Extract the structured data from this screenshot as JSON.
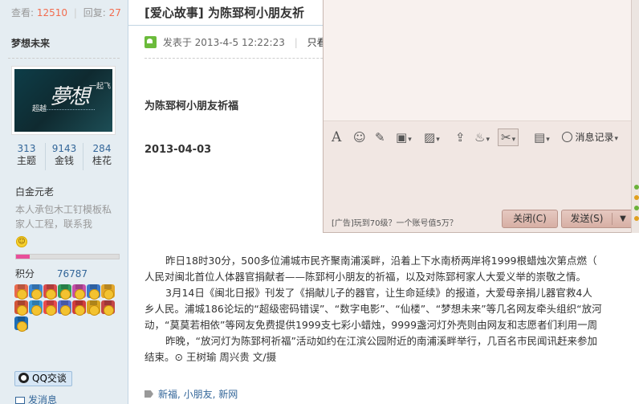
{
  "header": {
    "views_label": "查看:",
    "views_count": "12510",
    "replies_label": "回复:",
    "replies_count": "27",
    "thread_category": "[爱心故事]",
    "thread_title": "为陈郅柯小朋友祈"
  },
  "author": {
    "name": "梦想未来",
    "avatar_text_main": "夢想",
    "avatar_text_left": "超越",
    "avatar_text_right": "一起飞",
    "stats": [
      {
        "value": "313",
        "label": "主题"
      },
      {
        "value": "9143",
        "label": "金钱"
      },
      {
        "value": "284",
        "label": "桂花"
      }
    ],
    "group": "白金元老",
    "intro": "本人承包木工钉模板私家人工程，联系我",
    "level_progress": 0.13,
    "points_label": "积分",
    "points_value": "76787",
    "qq_label": "QQ交谈",
    "pm_label": "发消息"
  },
  "post": {
    "posted_prefix": "发表于",
    "posted_time": "2013-4-5 12:22:23",
    "only_author": "只看该",
    "heading": "为陈郅柯小朋友祈福",
    "date": "2013-04-03",
    "paragraphs": [
      "昨日18时30分，500多位浦城市民齐聚南浦溪畔，沿着上下水南桥两岸将1999根蜡烛次第点燃（",
      "人民对闽北首位人体器官捐献者——陈郅柯小朋友的祈福，以及对陈郅柯家人大爱义举的崇敬之情。",
      "3月14日《闽北日报》刊发了《捐献儿子的器官，让生命延续》的报道，大爱母亲捐儿器官救4人",
      "乡人民。浦城186论坛的“超级密码错误”、“数字电影”、“仙楼”、“梦想未来”等几名网友牵头组织“放河",
      "动，“莫莫若相依”等网友免费提供1999支七彩小蜡烛，9999盏河灯外壳则由网友和志愿者们利用一周",
      "昨晚，“放河灯为陈郅柯祈福”活动如约在江滨公园附近的南浦溪畔举行，几百名市民闻讯赶来参加",
      "结束。⊙ 王树瑜 周兴贵 文/摄"
    ],
    "tags": "新福, 小朋友, 新网"
  },
  "chat": {
    "toolbar_icons": [
      "font-icon",
      "emoji-icon",
      "magic-icon",
      "gift-icon",
      "image-icon",
      "upload-icon",
      "shake-icon",
      "screenshot-icon"
    ],
    "history_label": "消息记录",
    "ad_text": "[广告]玩到70级？一个账号值5万？",
    "close_label": "关闭(C)",
    "send_label": "发送(S)"
  },
  "colors": {
    "sidebar_bg": "#e5edf2",
    "link": "#336699",
    "count_accent": "#f26c4f",
    "chat_bg": "#f1e7e3",
    "progress_fill": "#e84f9a"
  }
}
